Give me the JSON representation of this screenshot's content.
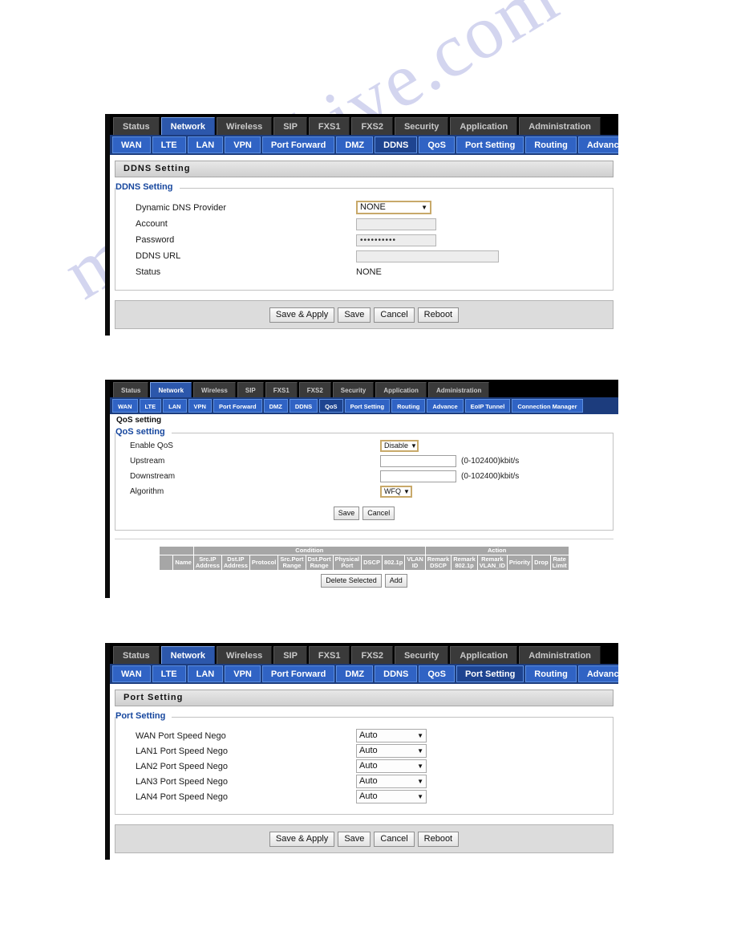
{
  "watermark": "manualshive.com",
  "main_tabs": [
    "Status",
    "Network",
    "Wireless",
    "SIP",
    "FXS1",
    "FXS2",
    "Security",
    "Application",
    "Administration"
  ],
  "active_main_tab": "Network",
  "sub_tabs": [
    "WAN",
    "LTE",
    "LAN",
    "VPN",
    "Port Forward",
    "DMZ",
    "DDNS",
    "QoS",
    "Port Setting",
    "Routing",
    "Advance",
    "EoIP Tunnel",
    "Connection Manager"
  ],
  "panel1": {
    "active_sub_tab": "DDNS",
    "title": "DDNS Setting",
    "legend": "DDNS Setting",
    "rows": [
      {
        "label": "Dynamic DNS Provider",
        "type": "select",
        "value": "NONE"
      },
      {
        "label": "Account",
        "type": "text",
        "value": ""
      },
      {
        "label": "Password",
        "type": "password",
        "value": "••••••••••"
      },
      {
        "label": "DDNS URL",
        "type": "text_wide",
        "value": ""
      },
      {
        "label": "Status",
        "type": "plain",
        "value": "NONE"
      }
    ],
    "buttons": [
      "Save & Apply",
      "Save",
      "Cancel",
      "Reboot"
    ]
  },
  "panel2": {
    "active_sub_tab": "QoS",
    "title": "QoS setting",
    "legend": "QoS setting",
    "rows": [
      {
        "label": "Enable QoS",
        "type": "select",
        "value": "Disable",
        "hint": ""
      },
      {
        "label": "Upstream",
        "type": "text",
        "value": "",
        "hint": "(0-102400)kbit/s"
      },
      {
        "label": "Downstream",
        "type": "text",
        "value": "",
        "hint": "(0-102400)kbit/s"
      },
      {
        "label": "Algorithm",
        "type": "select",
        "value": "WFQ",
        "hint": ""
      }
    ],
    "buttons": [
      "Save",
      "Cancel"
    ],
    "table": {
      "group_headers": [
        "Condition",
        "Action"
      ],
      "condition_columns": [
        "Src.IP Address",
        "Dst.IP Address",
        "Protocol",
        "Src.Port Range",
        "Dst.Port Range",
        "Physical Port",
        "DSCP",
        "802.1p",
        "VLAN ID"
      ],
      "action_columns": [
        "Remark DSCP",
        "Remark 802.1p",
        "Remark VLAN_ID",
        "Priority",
        "Drop",
        "Rate Limit"
      ],
      "name_column": "Name",
      "rows": []
    },
    "table_buttons": [
      "Delete Selected",
      "Add"
    ]
  },
  "panel3": {
    "active_sub_tab": "Port Setting",
    "title": "Port Setting",
    "legend": "Port Setting",
    "rows": [
      {
        "label": "WAN Port Speed Nego",
        "type": "select",
        "value": "Auto"
      },
      {
        "label": "LAN1 Port Speed Nego",
        "type": "select",
        "value": "Auto"
      },
      {
        "label": "LAN2 Port Speed Nego",
        "type": "select",
        "value": "Auto"
      },
      {
        "label": "LAN3 Port Speed Nego",
        "type": "select",
        "value": "Auto"
      },
      {
        "label": "LAN4 Port Speed Nego",
        "type": "select",
        "value": "Auto"
      }
    ],
    "buttons": [
      "Save & Apply",
      "Save",
      "Cancel",
      "Reboot"
    ]
  },
  "colors": {
    "nav_black": "#000000",
    "active_tab_blue": "#2c57ab",
    "subnav_blue": "#3063c4",
    "legend_blue": "#17479e",
    "table_gray": "#a6a6a6",
    "focus_gold": "#c8a96a",
    "watermark": "#b9bce6"
  }
}
